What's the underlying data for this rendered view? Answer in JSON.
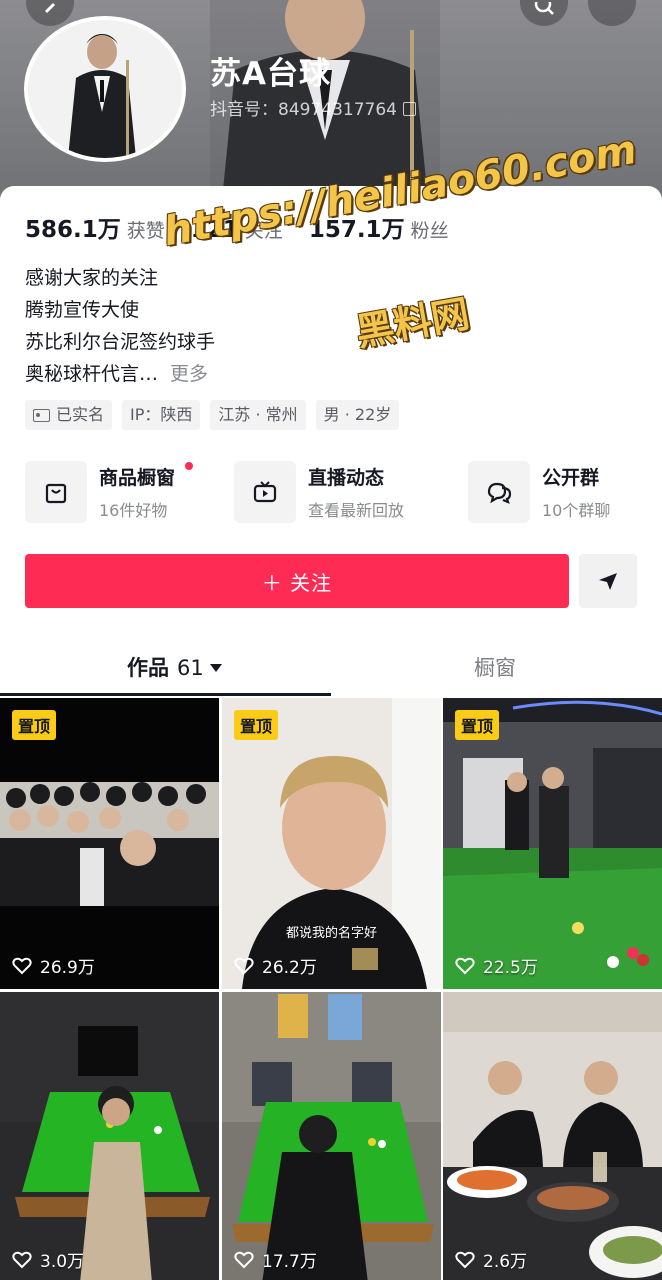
{
  "profile": {
    "nickname": "苏A台球",
    "douyin_id": "抖音号：84974317764"
  },
  "stats": [
    {
      "num": "586.1万",
      "label": "获赞"
    },
    {
      "num": "121",
      "label": "关注"
    },
    {
      "num": "157.1万",
      "label": "粉丝"
    }
  ],
  "bio": {
    "lines": [
      "感谢大家的关注",
      "腾勃宣传大使",
      "苏比利尔台泥签约球手",
      "奥秘球杆代言…"
    ],
    "more": "更多"
  },
  "tags": [
    "已实名",
    "IP：陕西",
    "江苏 · 常州",
    "男 · 22岁"
  ],
  "features": [
    {
      "title": "商品橱窗",
      "sub": "16件好物",
      "icon": "shopping-bag-icon"
    },
    {
      "title": "直播动态",
      "sub": "查看最新回放",
      "icon": "live-tv-icon"
    },
    {
      "title": "公开群",
      "sub": "10个群聊",
      "icon": "chat-bubbles-icon"
    }
  ],
  "follow_label": "＋ 关注",
  "tabs": {
    "works_label": "作品",
    "works_count": "61",
    "shop_label": "橱窗"
  },
  "videos": [
    {
      "pinned": "置顶",
      "likes": "26.9万"
    },
    {
      "pinned": "置顶",
      "likes": "26.2万",
      "caption": "都说我的名字好"
    },
    {
      "pinned": "置顶",
      "likes": "22.5万"
    },
    {
      "likes": "3.0万"
    },
    {
      "likes": "17.7万"
    },
    {
      "likes": "2.6万"
    }
  ],
  "watermark": {
    "url": "https://heiliao60.com",
    "name": "黑料网"
  },
  "colors": {
    "accent": "#fe2c55",
    "pin_badge": "#facc15",
    "watermark": "#f3c64a"
  }
}
